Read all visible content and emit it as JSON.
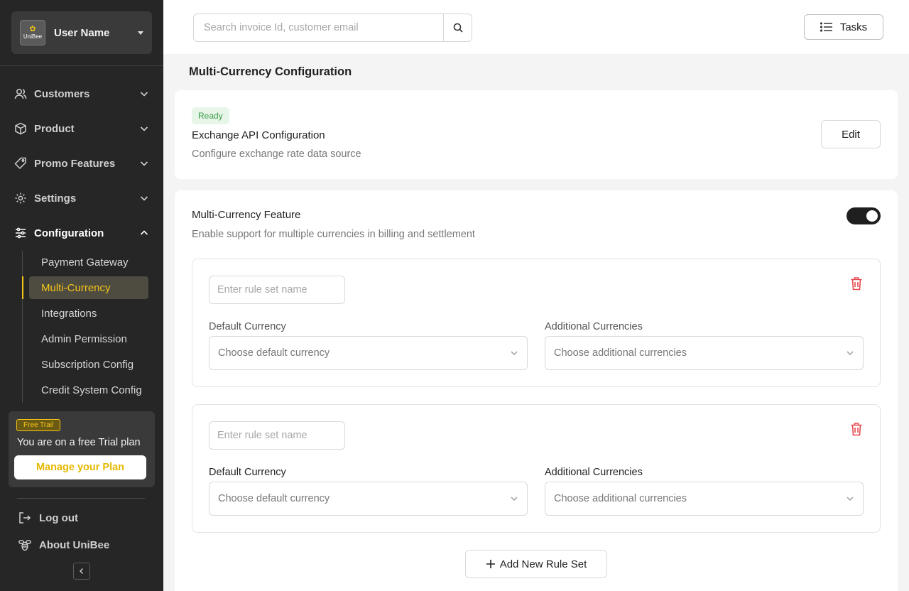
{
  "sidebar": {
    "user": {
      "name": "User Name",
      "logo_text": "UniBee"
    },
    "nav": [
      {
        "label": "Customers",
        "icon": "users-icon"
      },
      {
        "label": "Product",
        "icon": "box-icon"
      },
      {
        "label": "Promo Features",
        "icon": "tag-icon"
      },
      {
        "label": "Settings",
        "icon": "gear-icon"
      },
      {
        "label": "Configuration",
        "icon": "sliders-icon",
        "expanded": true
      }
    ],
    "subnav": [
      {
        "label": "Payment Gateway"
      },
      {
        "label": "Multi-Currency",
        "active": true
      },
      {
        "label": "Integrations"
      },
      {
        "label": "Admin Permission"
      },
      {
        "label": "Subscription Config"
      },
      {
        "label": "Credit System Config"
      }
    ],
    "trial": {
      "badge": "Free Trail",
      "text": "You are on a free Trial plan",
      "button": "Manage your Plan"
    },
    "logout": "Log out",
    "about": "About UniBee"
  },
  "header": {
    "search_placeholder": "Search invoice Id, customer email",
    "tasks_label": "Tasks"
  },
  "page": {
    "title": "Multi-Currency Configuration",
    "exchange_card": {
      "status": "Ready",
      "title": "Exchange API Configuration",
      "description": "Configure exchange rate data source",
      "edit_label": "Edit"
    },
    "feature_card": {
      "title": "Multi-Currency Feature",
      "description": "Enable support for multiple currencies in billing and settlement",
      "enabled": true
    },
    "rule_sets": [
      {
        "name_placeholder": "Enter rule set name",
        "default_label": "Default Currency",
        "default_placeholder": "Choose default currency",
        "additional_label": "Additional Currencies",
        "additional_placeholder": "Choose additional currencies"
      },
      {
        "name_placeholder": "Enter rule set name",
        "default_label": "Default Currency",
        "default_placeholder": "Choose default currency",
        "additional_label": "Additional Currencies",
        "additional_placeholder": "Choose additional currencies"
      }
    ],
    "add_rule_label": "Add New Rule Set"
  },
  "colors": {
    "sidebar_bg": "#262626",
    "accent": "#f5c518",
    "ready_green": "#3a9c47",
    "danger": "#e5484d"
  }
}
